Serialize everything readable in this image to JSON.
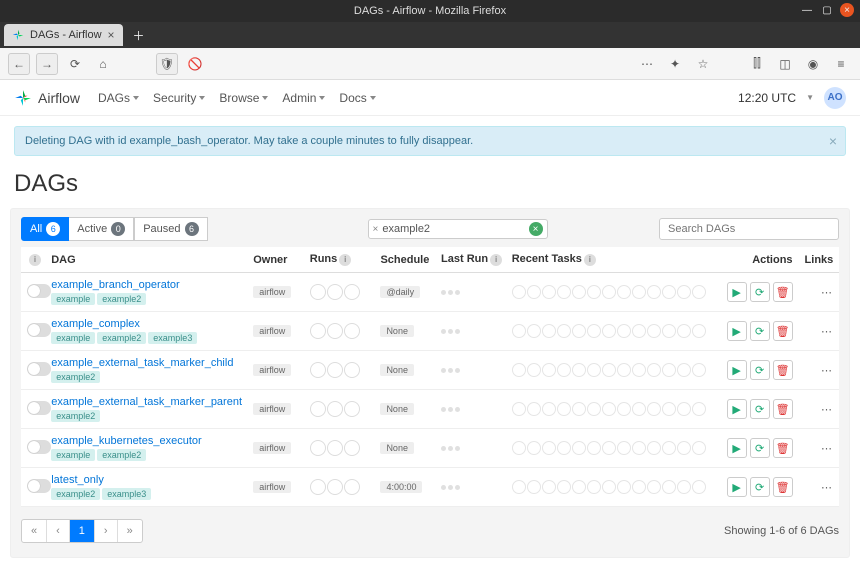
{
  "browser": {
    "window_title": "DAGs - Airflow - Mozilla Firefox",
    "tab_title": "DAGs - Airflow"
  },
  "nav": {
    "brand": "Airflow",
    "items": [
      "DAGs",
      "Security",
      "Browse",
      "Admin",
      "Docs"
    ],
    "time": "12:20 UTC",
    "user_initials": "AO"
  },
  "alert": "Deleting DAG with id example_bash_operator. May take a couple minutes to fully disappear.",
  "page_title": "DAGs",
  "filters": {
    "all_label": "All",
    "all_count": "6",
    "active_label": "Active",
    "active_count": "0",
    "paused_label": "Paused",
    "paused_count": "6"
  },
  "tag_filter": {
    "tag": "example2"
  },
  "search": {
    "placeholder": "Search DAGs"
  },
  "headers": {
    "dag": "DAG",
    "owner": "Owner",
    "runs": "Runs",
    "schedule": "Schedule",
    "last_run": "Last Run",
    "recent": "Recent Tasks",
    "actions": "Actions",
    "links": "Links"
  },
  "rows": [
    {
      "name": "example_branch_operator",
      "tags": [
        "example",
        "example2"
      ],
      "owner": "airflow",
      "schedule": "@daily"
    },
    {
      "name": "example_complex",
      "tags": [
        "example",
        "example2",
        "example3"
      ],
      "owner": "airflow",
      "schedule": "None"
    },
    {
      "name": "example_external_task_marker_child",
      "tags": [
        "example2"
      ],
      "owner": "airflow",
      "schedule": "None"
    },
    {
      "name": "example_external_task_marker_parent",
      "tags": [
        "example2"
      ],
      "owner": "airflow",
      "schedule": "None"
    },
    {
      "name": "example_kubernetes_executor",
      "tags": [
        "example",
        "example2"
      ],
      "owner": "airflow",
      "schedule": "None"
    },
    {
      "name": "latest_only",
      "tags": [
        "example2",
        "example3"
      ],
      "owner": "airflow",
      "schedule": "4:00:00"
    }
  ],
  "pagination": {
    "page": "1",
    "showing": "Showing 1-6 of 6 DAGs"
  }
}
